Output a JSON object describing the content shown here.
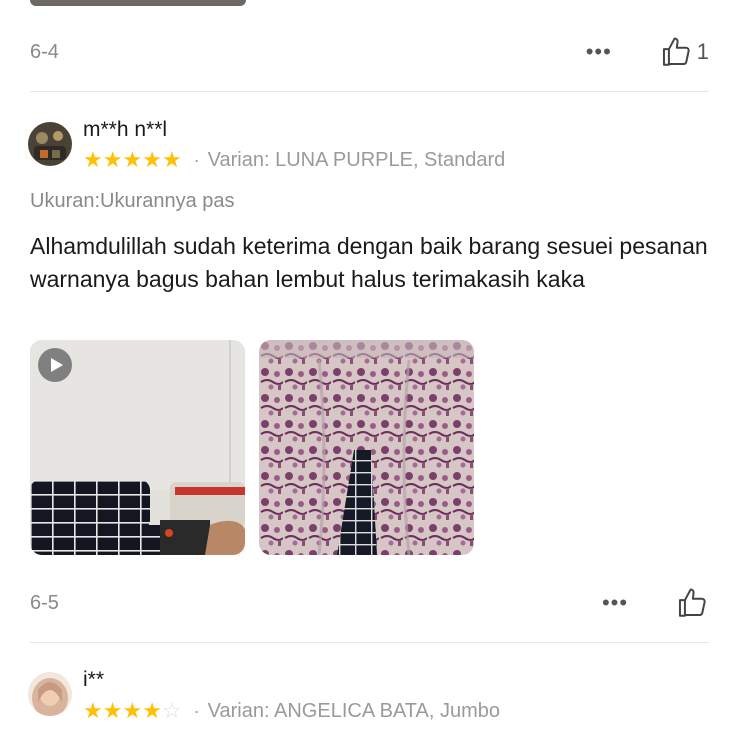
{
  "previous_review": {
    "date": "6-4",
    "more_label": "•••",
    "like_count": "1"
  },
  "review": {
    "username": "m**h n**l",
    "rating": 5,
    "separator": "·",
    "variant": "Varian: LUNA PURPLE, Standard",
    "size_line": "Ukuran:Ukurannya pas",
    "text": "Alhamdulillah sudah keterima dengan baik barang sesuei pesanan warnanya bagus bahan lembut halus terimakasih kaka",
    "media": [
      {
        "type": "video",
        "icon": "play-icon"
      },
      {
        "type": "image"
      }
    ],
    "date": "6-5",
    "more_label": "•••"
  },
  "next_review": {
    "username": "i**",
    "rating": 4,
    "separator": "·",
    "variant": "Varian: ANGELICA BATA, Jumbo"
  },
  "colors": {
    "star_filled": "#ffc107",
    "star_empty": "#e0e0e0",
    "muted_text": "#9a9a9a"
  }
}
